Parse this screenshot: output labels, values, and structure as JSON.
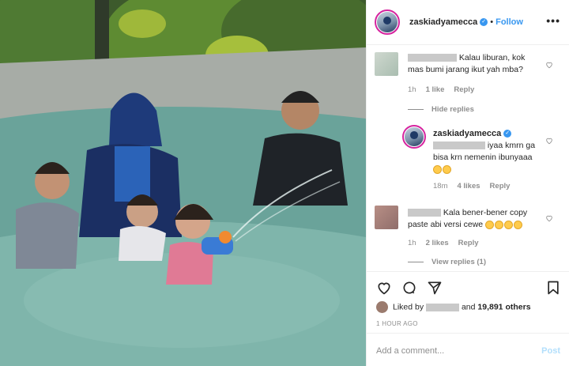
{
  "post": {
    "username": "zaskiadyamecca",
    "follow_label": "Follow",
    "more_label": "•••",
    "separator": "•"
  },
  "comments": [
    {
      "text": "Kalau liburan, kok mas bumi jarang ikut yah mba?",
      "age": "1h",
      "likes": "1 like",
      "reply_label": "Reply",
      "toggle_label": "Hide replies",
      "reply": {
        "username": "zaskiadyamecca",
        "text": "iyaa kmrn ga bisa krn nemenin ibunyaaa",
        "emoji_count": 2,
        "age": "18m",
        "likes": "4 likes",
        "reply_label": "Reply"
      }
    },
    {
      "text": "Kala bener-bener copy paste abi versi cewe",
      "emoji_count": 4,
      "age": "1h",
      "likes": "2 likes",
      "reply_label": "Reply",
      "toggle_label": "View replies (1)"
    }
  ],
  "actions": {
    "liked_by_label": "Liked by",
    "and_label": "and",
    "others_count": "19,891 others",
    "timestamp": "1 HOUR AGO"
  },
  "add_comment": {
    "placeholder": "Add a comment...",
    "post_label": "Post"
  },
  "colors": {
    "accent": "#3897f0",
    "post_disabled": "#b2dffc",
    "muted": "#8e8e8e",
    "text": "#262626"
  },
  "icons": [
    "heart-icon",
    "comment-icon",
    "share-icon",
    "bookmark-icon",
    "verified-icon",
    "more-icon"
  ]
}
